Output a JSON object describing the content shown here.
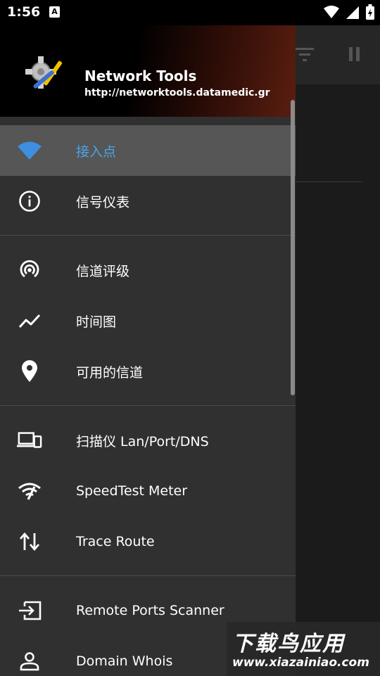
{
  "status_bar": {
    "time": "1:56",
    "notification": "A"
  },
  "app": {
    "name": "Network Tools",
    "url": "http://networktools.datamedic.gr"
  },
  "menu": {
    "group1": [
      {
        "label": "接入点",
        "icon": "wifi-icon",
        "active": true
      },
      {
        "label": "信号仪表",
        "icon": "info-icon"
      }
    ],
    "group2": [
      {
        "label": "信道评级",
        "icon": "signal-rings-icon"
      },
      {
        "label": "时间图",
        "icon": "line-chart-icon"
      },
      {
        "label": "可用的信道",
        "icon": "location-pin-icon"
      }
    ],
    "group3": [
      {
        "label": "扫描仪 Lan/Port/DNS",
        "icon": "devices-icon"
      },
      {
        "label": "SpeedTest Meter",
        "icon": "wifi-speed-icon"
      },
      {
        "label": "Trace Route",
        "icon": "route-arrows-icon"
      }
    ],
    "group4": [
      {
        "label": "Remote Ports Scanner",
        "icon": "login-arrow-icon"
      },
      {
        "label": "Domain Whois",
        "icon": "person-icon"
      }
    ]
  },
  "watermark": {
    "main": "下载鸟应用",
    "sub": "www.xiazainiao.com"
  },
  "colors": {
    "accent": "#4aa3e8",
    "drawer_bg": "#303030",
    "active_bg": "#565656"
  }
}
